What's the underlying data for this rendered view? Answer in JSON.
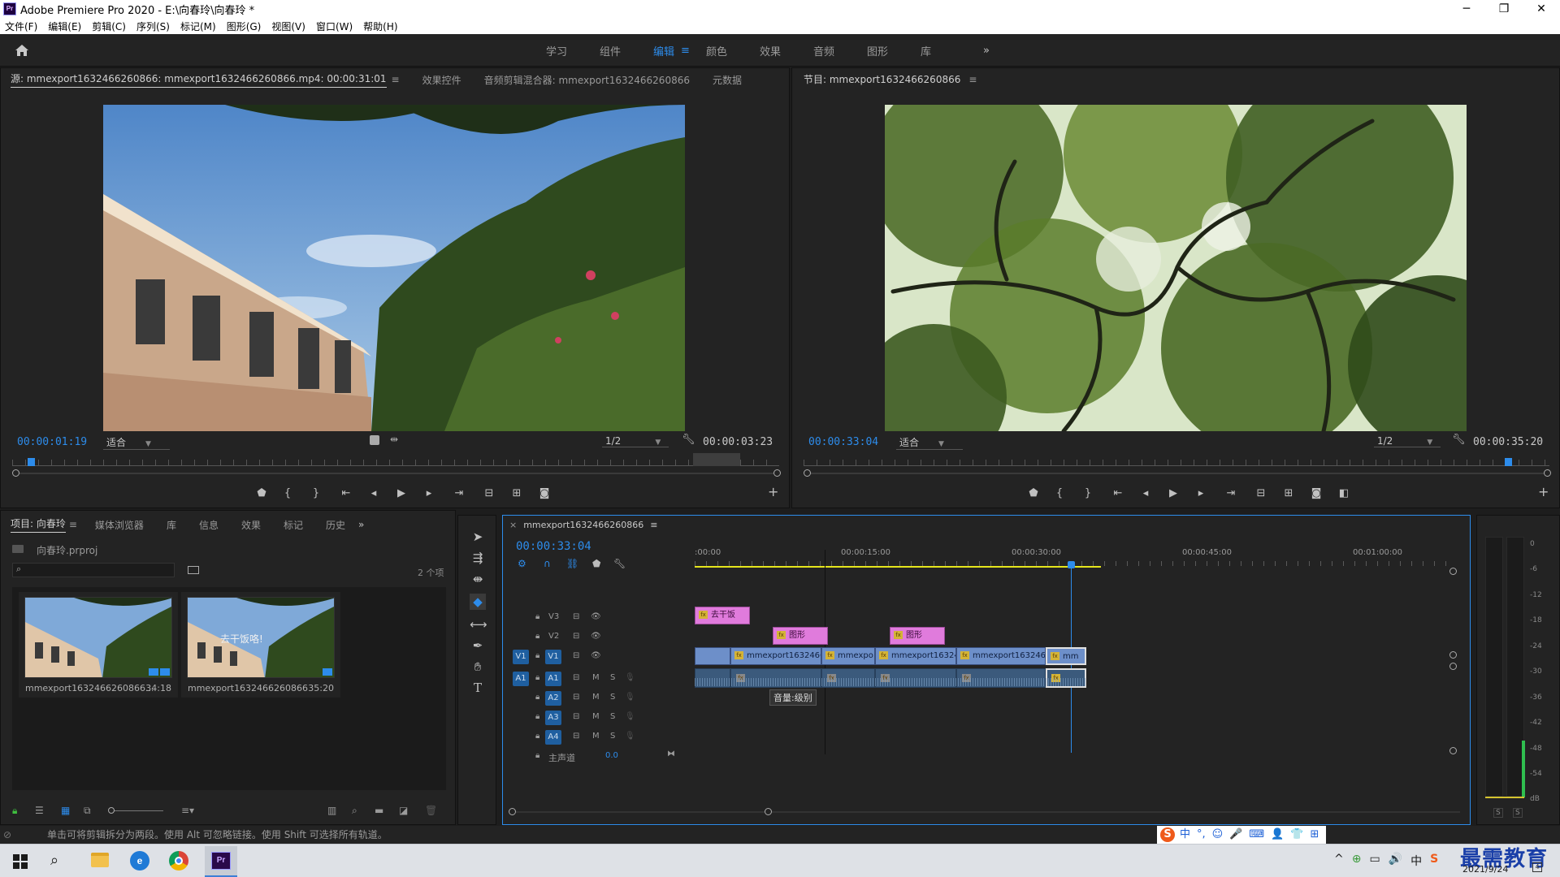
{
  "window": {
    "title": "Adobe Premiere Pro 2020 - E:\\向春玲\\向春玲 *",
    "controls": [
      "─",
      "❐",
      "✕"
    ],
    "app_badge": "Pr"
  },
  "menu": [
    "文件(F)",
    "编辑(E)",
    "剪辑(C)",
    "序列(S)",
    "标记(M)",
    "图形(G)",
    "视图(V)",
    "窗口(W)",
    "帮助(H)"
  ],
  "workspaces": {
    "tabs": [
      "学习",
      "组件",
      "编辑",
      "颜色",
      "效果",
      "音频",
      "图形",
      "库"
    ],
    "active": "编辑",
    "more": "»",
    "menu_icon": "≡"
  },
  "source_panel": {
    "tabs": [
      "源: mmexport1632466260866: mmexport1632466260866.mp4: 00:00:31:01",
      "效果控件",
      "音频剪辑混合器: mmexport1632466260866",
      "元数据"
    ],
    "menu_icon": "≡",
    "timecode": "00:00:01:19",
    "fit": "适合",
    "resolution": "1/2",
    "duration": "00:00:03:23",
    "playhead": 0.02,
    "buttons": [
      "marker",
      "mark-in",
      "mark-out",
      "go-to-in",
      "step-back",
      "play",
      "step-forward",
      "go-to-out",
      "insert",
      "overwrite",
      "export-frame",
      "add"
    ]
  },
  "program_panel": {
    "tab": "节目: mmexport1632466260866",
    "menu_icon": "≡",
    "timecode": "00:00:33:04",
    "fit": "适合",
    "resolution": "1/2",
    "duration": "00:00:35:20",
    "playhead": 0.94,
    "buttons": [
      "marker",
      "mark-in",
      "mark-out",
      "go-to-in",
      "step-back",
      "play",
      "step-forward",
      "go-to-out",
      "lift",
      "extract",
      "export-frame",
      "compare",
      "add"
    ]
  },
  "project_panel": {
    "tabs": [
      "项目: 向春玲",
      "媒体浏览器",
      "库",
      "信息",
      "效果",
      "标记",
      "历史"
    ],
    "more": "»",
    "project_file": "向春玲.prproj",
    "item_count": "2 个项",
    "items": [
      {
        "name": "mmexport1632466260866...",
        "duration": "34:18"
      },
      {
        "name": "mmexport1632466260866",
        "duration": "35:20",
        "overlay_text": "去干饭咯!"
      }
    ]
  },
  "tools": [
    "selection-tool",
    "track-select-tool",
    "ripple-edit-tool",
    "razor-tool",
    "slip-tool",
    "pen-tool",
    "hand-tool",
    "type-tool"
  ],
  "timeline": {
    "sequence_tab": "mmexport1632466260866",
    "close": "×",
    "timecode": "00:00:33:04",
    "ruler": [
      ":00:00",
      "00:00:15:00",
      "00:00:30:00",
      "00:00:45:00",
      "00:01:00:00"
    ],
    "tracks": [
      {
        "id": "V3",
        "type": "video"
      },
      {
        "id": "V2",
        "type": "video"
      },
      {
        "id": "V1",
        "type": "video",
        "target": "V1"
      },
      {
        "id": "A1",
        "type": "audio",
        "target": "A1"
      },
      {
        "id": "A2",
        "type": "audio"
      },
      {
        "id": "A3",
        "type": "audio"
      },
      {
        "id": "A4",
        "type": "audio"
      }
    ],
    "track_buttons": {
      "mute": "M",
      "solo": "S"
    },
    "master": {
      "label": "主声道",
      "value": "0.0"
    },
    "clips_v3": [
      {
        "label": "去干饭"
      }
    ],
    "clips_v2": [
      {
        "label": "图形"
      },
      {
        "label": "图形"
      }
    ],
    "clips_v1": [
      {
        "label": ""
      },
      {
        "label": "mmexport1632466"
      },
      {
        "label": "mmexpo"
      },
      {
        "label": "mmexport16324"
      },
      {
        "label": "mmexport1632466"
      },
      {
        "label": "mm"
      }
    ],
    "tooltip": "音量:级别"
  },
  "meter": {
    "scale": [
      "0",
      "-6",
      "-12",
      "-18",
      "-24",
      "-30",
      "-36",
      "-42",
      "-48",
      "-54",
      "dB"
    ],
    "solo": [
      "S",
      "S"
    ]
  },
  "status": "单击可将剪辑拆分为两段。使用 Alt 可忽略链接。使用 Shift 可选择所有轨道。",
  "ime": {
    "badge": "S",
    "items": [
      "中",
      "°,",
      "☺",
      "🎤",
      "⌨",
      "👤",
      "👕",
      "⊞"
    ]
  },
  "taskbar": {
    "date": "2021/9/24",
    "watermark": "最需教育",
    "tray": [
      "^",
      "⊕",
      "▭",
      "🔊",
      "中",
      "S"
    ],
    "apps": [
      "windows-start",
      "search",
      "file-explorer",
      "edge",
      "chrome",
      "premiere"
    ]
  },
  "colors": {
    "accent": "#2d8ceb",
    "video_clip": "#6d8fc9",
    "graphic_clip": "#e07bdc",
    "audio_clip": "#3b5a7c",
    "work_area": "#e5e51c"
  }
}
